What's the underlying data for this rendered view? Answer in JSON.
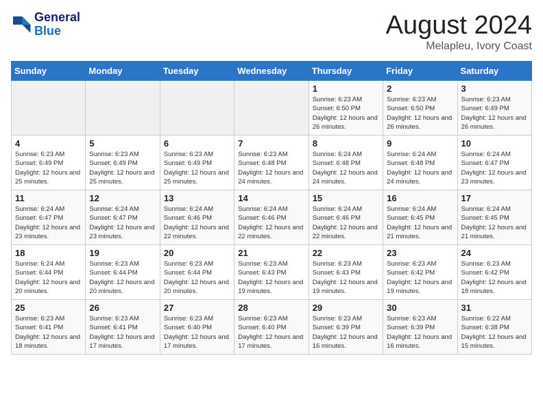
{
  "logo": {
    "line1": "General",
    "line2": "Blue"
  },
  "title": "August 2024",
  "subtitle": "Melapleu, Ivory Coast",
  "weekdays": [
    "Sunday",
    "Monday",
    "Tuesday",
    "Wednesday",
    "Thursday",
    "Friday",
    "Saturday"
  ],
  "weeks": [
    [
      {
        "day": "",
        "empty": true
      },
      {
        "day": "",
        "empty": true
      },
      {
        "day": "",
        "empty": true
      },
      {
        "day": "",
        "empty": true
      },
      {
        "day": "1",
        "sunrise": "6:23 AM",
        "sunset": "6:50 PM",
        "daylight": "12 hours and 26 minutes."
      },
      {
        "day": "2",
        "sunrise": "6:23 AM",
        "sunset": "6:50 PM",
        "daylight": "12 hours and 26 minutes."
      },
      {
        "day": "3",
        "sunrise": "6:23 AM",
        "sunset": "6:49 PM",
        "daylight": "12 hours and 26 minutes."
      }
    ],
    [
      {
        "day": "4",
        "sunrise": "6:23 AM",
        "sunset": "6:49 PM",
        "daylight": "12 hours and 25 minutes."
      },
      {
        "day": "5",
        "sunrise": "6:23 AM",
        "sunset": "6:49 PM",
        "daylight": "12 hours and 25 minutes."
      },
      {
        "day": "6",
        "sunrise": "6:23 AM",
        "sunset": "6:49 PM",
        "daylight": "12 hours and 25 minutes."
      },
      {
        "day": "7",
        "sunrise": "6:23 AM",
        "sunset": "6:48 PM",
        "daylight": "12 hours and 24 minutes."
      },
      {
        "day": "8",
        "sunrise": "6:24 AM",
        "sunset": "6:48 PM",
        "daylight": "12 hours and 24 minutes."
      },
      {
        "day": "9",
        "sunrise": "6:24 AM",
        "sunset": "6:48 PM",
        "daylight": "12 hours and 24 minutes."
      },
      {
        "day": "10",
        "sunrise": "6:24 AM",
        "sunset": "6:47 PM",
        "daylight": "12 hours and 23 minutes."
      }
    ],
    [
      {
        "day": "11",
        "sunrise": "6:24 AM",
        "sunset": "6:47 PM",
        "daylight": "12 hours and 23 minutes."
      },
      {
        "day": "12",
        "sunrise": "6:24 AM",
        "sunset": "6:47 PM",
        "daylight": "12 hours and 23 minutes."
      },
      {
        "day": "13",
        "sunrise": "6:24 AM",
        "sunset": "6:46 PM",
        "daylight": "12 hours and 22 minutes."
      },
      {
        "day": "14",
        "sunrise": "6:24 AM",
        "sunset": "6:46 PM",
        "daylight": "12 hours and 22 minutes."
      },
      {
        "day": "15",
        "sunrise": "6:24 AM",
        "sunset": "6:46 PM",
        "daylight": "12 hours and 22 minutes."
      },
      {
        "day": "16",
        "sunrise": "6:24 AM",
        "sunset": "6:45 PM",
        "daylight": "12 hours and 21 minutes."
      },
      {
        "day": "17",
        "sunrise": "6:24 AM",
        "sunset": "6:45 PM",
        "daylight": "12 hours and 21 minutes."
      }
    ],
    [
      {
        "day": "18",
        "sunrise": "6:24 AM",
        "sunset": "6:44 PM",
        "daylight": "12 hours and 20 minutes."
      },
      {
        "day": "19",
        "sunrise": "6:23 AM",
        "sunset": "6:44 PM",
        "daylight": "12 hours and 20 minutes."
      },
      {
        "day": "20",
        "sunrise": "6:23 AM",
        "sunset": "6:44 PM",
        "daylight": "12 hours and 20 minutes."
      },
      {
        "day": "21",
        "sunrise": "6:23 AM",
        "sunset": "6:43 PM",
        "daylight": "12 hours and 19 minutes."
      },
      {
        "day": "22",
        "sunrise": "6:23 AM",
        "sunset": "6:43 PM",
        "daylight": "12 hours and 19 minutes."
      },
      {
        "day": "23",
        "sunrise": "6:23 AM",
        "sunset": "6:42 PM",
        "daylight": "12 hours and 19 minutes."
      },
      {
        "day": "24",
        "sunrise": "6:23 AM",
        "sunset": "6:42 PM",
        "daylight": "12 hours and 18 minutes."
      }
    ],
    [
      {
        "day": "25",
        "sunrise": "6:23 AM",
        "sunset": "6:41 PM",
        "daylight": "12 hours and 18 minutes."
      },
      {
        "day": "26",
        "sunrise": "6:23 AM",
        "sunset": "6:41 PM",
        "daylight": "12 hours and 17 minutes."
      },
      {
        "day": "27",
        "sunrise": "6:23 AM",
        "sunset": "6:40 PM",
        "daylight": "12 hours and 17 minutes."
      },
      {
        "day": "28",
        "sunrise": "6:23 AM",
        "sunset": "6:40 PM",
        "daylight": "12 hours and 17 minutes."
      },
      {
        "day": "29",
        "sunrise": "6:23 AM",
        "sunset": "6:39 PM",
        "daylight": "12 hours and 16 minutes."
      },
      {
        "day": "30",
        "sunrise": "6:23 AM",
        "sunset": "6:39 PM",
        "daylight": "12 hours and 16 minutes."
      },
      {
        "day": "31",
        "sunrise": "6:22 AM",
        "sunset": "6:38 PM",
        "daylight": "12 hours and 15 minutes."
      }
    ]
  ]
}
